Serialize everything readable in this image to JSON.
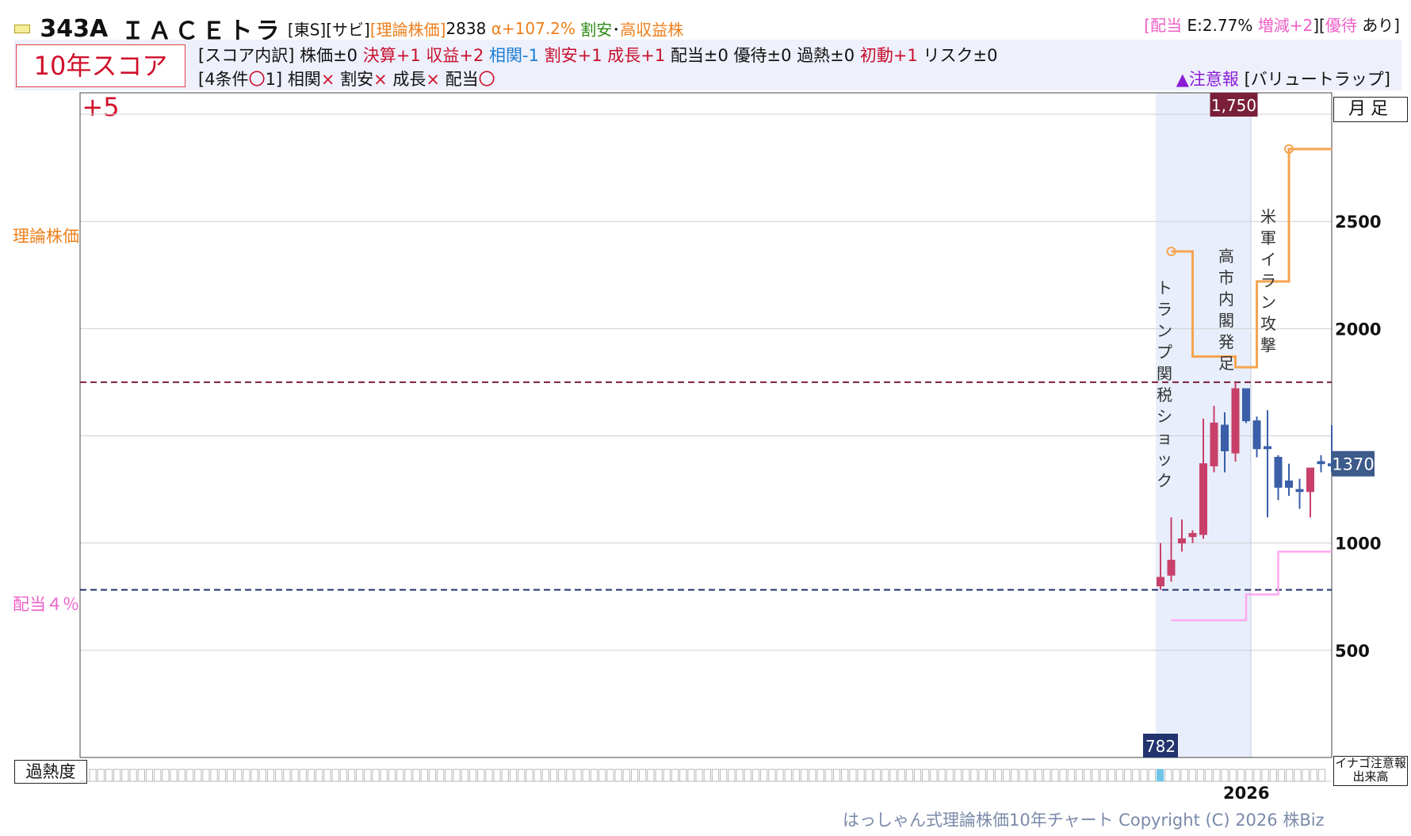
{
  "header": {
    "code": "343A",
    "name": "ＩＡＣＥトラ",
    "market": "[東S][サビ]",
    "theory_label": "[理論株価]",
    "theory_value": "2838",
    "alpha": "α+107.2%",
    "tag_cheap": "割安",
    "tag_sep": "･",
    "tag_income": "高収益株",
    "dividend_bracket_open": "[",
    "dividend_label": "配当",
    "dividend_value": "E:2.77%",
    "dividend_change": "増減+2",
    "dividend_bracket_close": "][",
    "yutai_label": "優待",
    "yutai_value": "あり]"
  },
  "score": {
    "box": "10年スコア+5",
    "breakdown_label": "[スコア内訳]",
    "items": [
      {
        "text": "株価±0",
        "color": "#111111"
      },
      {
        "text": "決算+1",
        "color": "#c8102e"
      },
      {
        "text": "収益+2",
        "color": "#c8102e"
      },
      {
        "text": "相関-1",
        "color": "#1a7fd6"
      },
      {
        "text": "割安+1",
        "color": "#c8102e"
      },
      {
        "text": "成長+1",
        "color": "#c8102e"
      },
      {
        "text": "配当±0",
        "color": "#111111"
      },
      {
        "text": "優待±0",
        "color": "#111111"
      },
      {
        "text": "過熱±0",
        "color": "#111111"
      },
      {
        "text": "初動+1",
        "color": "#c8102e"
      },
      {
        "text": "リスク±0",
        "color": "#111111"
      }
    ],
    "conditions_label": "[4条件",
    "conditions_circle": "〇",
    "conditions_count": "1]",
    "conditions": [
      {
        "name": "相関",
        "mark": "×"
      },
      {
        "name": "割安",
        "mark": "×"
      },
      {
        "name": "成長",
        "mark": "×"
      },
      {
        "name": "配当",
        "mark": "〇"
      }
    ],
    "warning": "▲注意報",
    "warning_tag": "[バリュートラップ]"
  },
  "controls": {
    "period_button": "月足",
    "heat_label": "過熱度",
    "inago_line1": "イナゴ注意報",
    "inago_line2": "出来高",
    "year_label": "2026",
    "copyright": "はっしゃん式理論株価10年チャート Copyright (C) 2026 株Biz"
  },
  "colors": {
    "up": "#c8406a",
    "down": "#3a5ea8",
    "theory_line": "#f7a450",
    "dividend_line": "#ffa8f0",
    "high_line": "#7a1f3a",
    "low_line": "#22336e",
    "current_badge": "#3c5a8a",
    "shade": "#e8eefb"
  },
  "chart_data": {
    "type": "candlestick",
    "ylim": [
      0,
      3100
    ],
    "y_ticks": [
      500,
      1000,
      2000,
      2500
    ],
    "side_labels": {
      "theory": "理論株価",
      "dividend": "配当４％"
    },
    "high": {
      "value": 1750,
      "label": "1,750"
    },
    "low": {
      "value": 782,
      "label": "782"
    },
    "current": {
      "value": 1370,
      "label": "1370"
    },
    "candles": [
      {
        "open": 800,
        "high": 1000,
        "low": 782,
        "close": 840
      },
      {
        "open": 850,
        "high": 1120,
        "low": 820,
        "close": 920
      },
      {
        "open": 1000,
        "high": 1110,
        "low": 960,
        "close": 1020
      },
      {
        "open": 1030,
        "high": 1060,
        "low": 1000,
        "close": 1045
      },
      {
        "open": 1040,
        "high": 1580,
        "low": 1020,
        "close": 1370
      },
      {
        "open": 1360,
        "high": 1640,
        "low": 1330,
        "close": 1560
      },
      {
        "open": 1550,
        "high": 1610,
        "low": 1330,
        "close": 1430
      },
      {
        "open": 1420,
        "high": 1750,
        "low": 1380,
        "close": 1720
      },
      {
        "open": 1720,
        "high": 1720,
        "low": 1560,
        "close": 1570
      },
      {
        "open": 1570,
        "high": 1590,
        "low": 1400,
        "close": 1440
      },
      {
        "open": 1450,
        "high": 1620,
        "low": 1120,
        "close": 1440
      },
      {
        "open": 1400,
        "high": 1410,
        "low": 1200,
        "close": 1260
      },
      {
        "open": 1290,
        "high": 1370,
        "low": 1220,
        "close": 1260
      },
      {
        "open": 1250,
        "high": 1300,
        "low": 1160,
        "close": 1240
      },
      {
        "open": 1240,
        "high": 1340,
        "low": 1120,
        "close": 1350
      },
      {
        "open": 1380,
        "high": 1410,
        "low": 1330,
        "close": 1370
      },
      {
        "open": 1370,
        "high": 1550,
        "low": 1330,
        "close": 1360
      }
    ],
    "theory_steps": [
      {
        "from": 1,
        "to": 3,
        "value": 2360
      },
      {
        "from": 3,
        "to": 7,
        "value": 1870
      },
      {
        "from": 7,
        "to": 9,
        "value": 1820
      },
      {
        "from": 9,
        "to": 12,
        "value": 2220
      },
      {
        "from": 12,
        "to": 16,
        "value": 2838
      }
    ],
    "dividend_steps": [
      {
        "from": 1,
        "to": 8,
        "value": 640
      },
      {
        "from": 8,
        "to": 11,
        "value": 760
      },
      {
        "from": 11,
        "to": 13,
        "value": 960
      },
      {
        "from": 13,
        "to": 16,
        "value": 960
      }
    ],
    "annotations": [
      {
        "text": "トランプ関税ショック",
        "index": 0
      },
      {
        "text": "高市内閣発足",
        "index": 6
      },
      {
        "text": "米軍イラン攻撃",
        "index": 10
      }
    ],
    "hot_index": 0
  }
}
